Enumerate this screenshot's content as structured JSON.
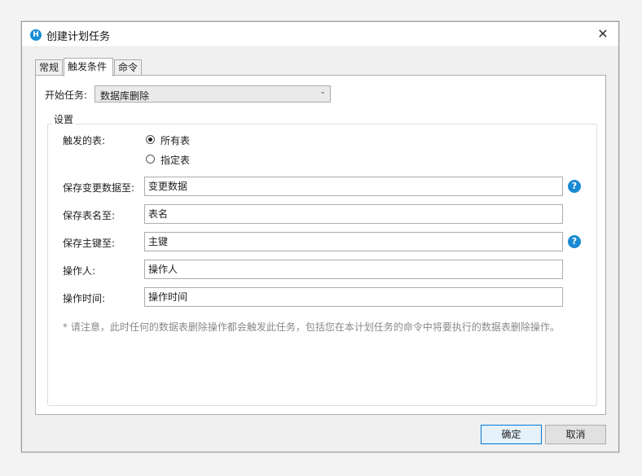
{
  "window": {
    "title": "创建计划任务",
    "app_icon": "H"
  },
  "close_glyph": "✕",
  "tabs": [
    {
      "label": "常规"
    },
    {
      "label": "触发条件"
    },
    {
      "label": "命令"
    }
  ],
  "start_task": {
    "label": "开始任务:",
    "value": "数据库删除",
    "arrow": "⌄"
  },
  "settings": {
    "title": "设置",
    "trigger_label": "触发的表:",
    "radio_all": "所有表",
    "radio_specific": "指定表",
    "radio_selected": "所有表"
  },
  "fields": {
    "save_changed_data": {
      "label": "保存变更数据至:",
      "value": "变更数据"
    },
    "save_table_name": {
      "label": "保存表名至:",
      "value": "表名"
    },
    "save_primary_key": {
      "label": "保存主键至:",
      "value": "主键"
    },
    "operator": {
      "label": "操作人:",
      "value": "操作人"
    },
    "operation_time": {
      "label": "操作时间:",
      "value": "操作时间"
    }
  },
  "help_glyph": "?",
  "note": "* 请注意，此时任何的数据表删除操作都会触发此任务，包括您在本计划任务的命令中将要执行的数据表删除操作。",
  "buttons": {
    "ok": "确定",
    "cancel": "取消"
  },
  "colors": {
    "accent": "#0078d7",
    "help_icon": "#1b8ad4",
    "note_text": "#8a8a8a"
  }
}
